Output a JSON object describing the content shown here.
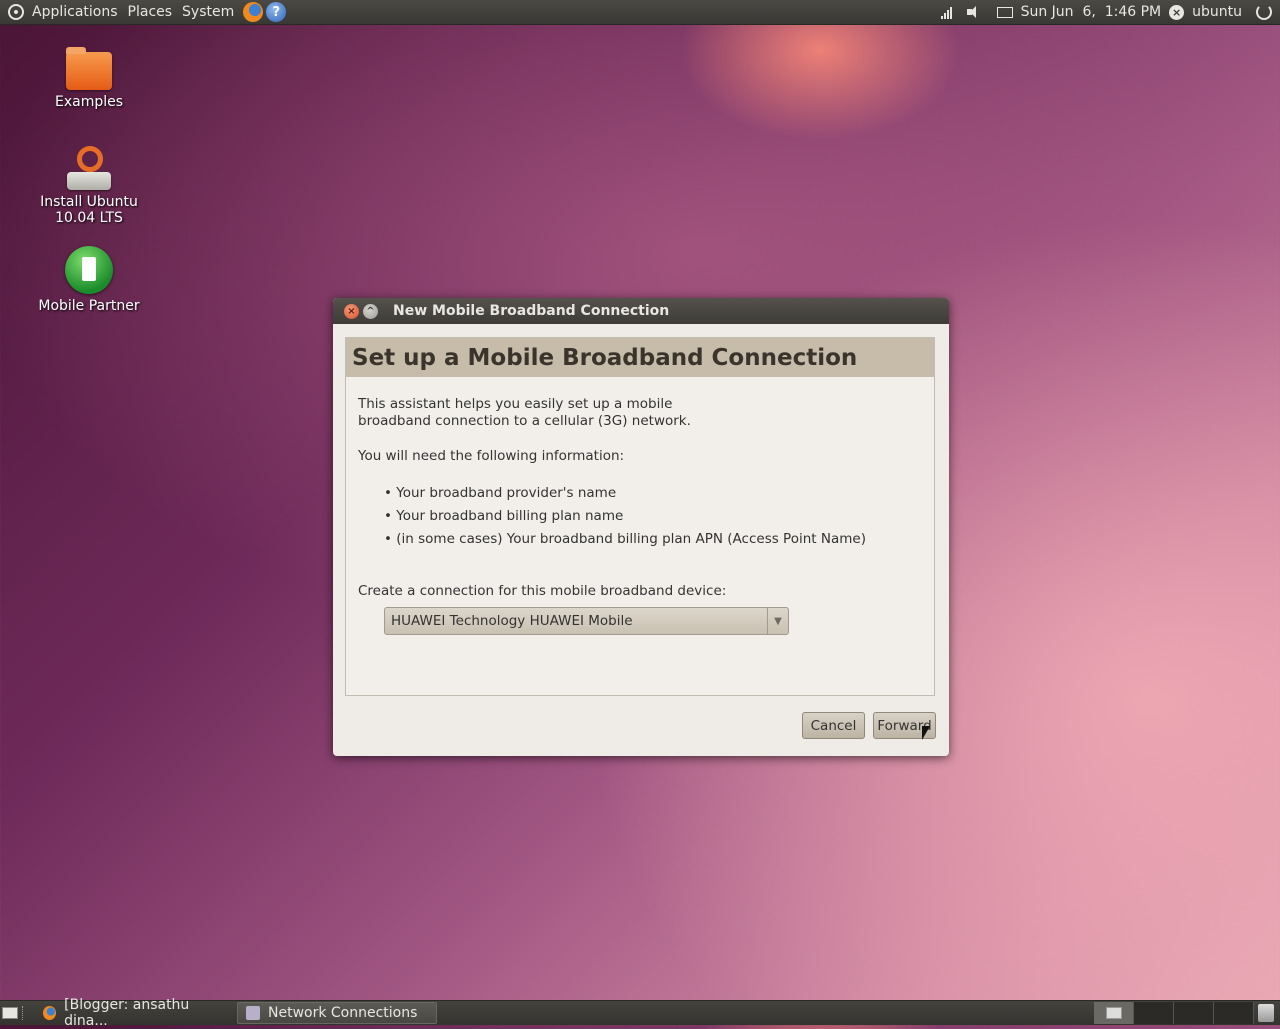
{
  "top_panel": {
    "menus": [
      "Applications",
      "Places",
      "System"
    ],
    "clock": "Sun Jun  6,  1:46 PM",
    "user": "ubuntu"
  },
  "desktop": {
    "icons": [
      {
        "label": "Examples",
        "icon": "folder-icon"
      },
      {
        "label": "Install Ubuntu 10.04 LTS",
        "icon": "installer-icon"
      },
      {
        "label": "Mobile Partner",
        "icon": "mobile-partner-icon"
      }
    ]
  },
  "dialog": {
    "window_title": "New Mobile Broadband Connection",
    "heading": "Set up a Mobile Broadband Connection",
    "intro_line1": "This assistant helps you easily set up a mobile",
    "intro_line2": "broadband connection to a cellular (3G) network.",
    "need_text": "You will need the following information:",
    "bullets": [
      "Your broadband provider's name",
      "Your broadband billing plan name",
      "(in some cases) Your broadband billing plan APN (Access Point Name)"
    ],
    "device_label": "Create a connection for this mobile broadband device:",
    "device_value": "HUAWEI Technology HUAWEI Mobile",
    "cancel_label": "Cancel",
    "forward_label": "Forward"
  },
  "bottom_panel": {
    "tasks": [
      {
        "label": "[Blogger: ansathu dina...",
        "icon": "firefox-icon"
      },
      {
        "label": "Network Connections",
        "icon": "network-icon"
      }
    ]
  }
}
